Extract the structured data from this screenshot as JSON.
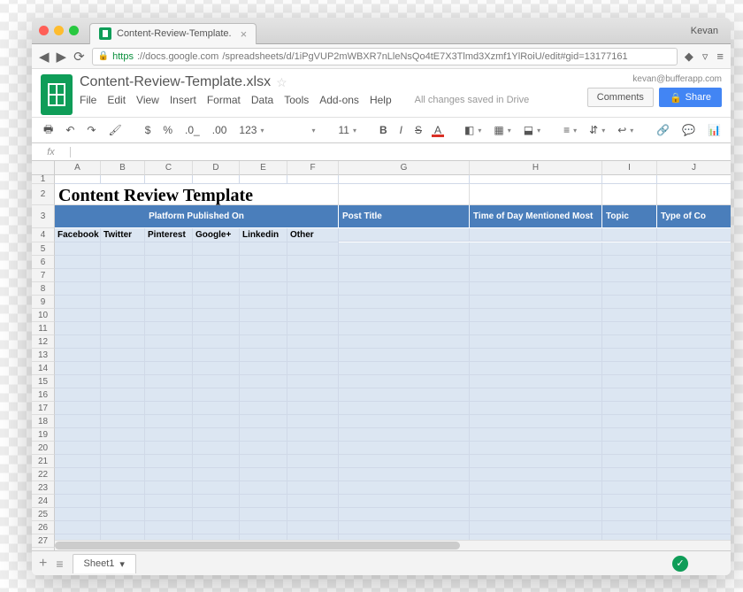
{
  "browser": {
    "tab_title": "Content-Review-Template.",
    "user": "Kevan",
    "https": "https",
    "url_host": "://docs.google.com",
    "url_path": "/spreadsheets/d/1iPgVUP2mWBXR7nLleNsQo4tE7X3Tlmd3Xzmf1YlRoiU/edit#gid=13177161"
  },
  "doc": {
    "title": "Content-Review-Template.xlsx",
    "email": "kevan@bufferapp.com",
    "comments_btn": "Comments",
    "share_btn": "Share",
    "save_status": "All changes saved in Drive",
    "menu": {
      "file": "File",
      "edit": "Edit",
      "view": "View",
      "insert": "Insert",
      "format": "Format",
      "data": "Data",
      "tools": "Tools",
      "addons": "Add-ons",
      "help": "Help"
    }
  },
  "toolbar": {
    "currency": "$",
    "percent": "%",
    "dec_dec": ".0_",
    "dec_inc": ".00",
    "fmt": "123",
    "font_size": "11",
    "bold": "B",
    "italic": "I",
    "strike": "S",
    "textA": "A"
  },
  "fx": {
    "label": "fx"
  },
  "columns": [
    "A",
    "B",
    "C",
    "D",
    "E",
    "F",
    "G",
    "H",
    "I",
    "J"
  ],
  "sheet": {
    "title_cell": "Content Review Template",
    "header_platform": "Platform Published On",
    "header_post": "Post Title",
    "header_time": "Time of Day Mentioned Most",
    "header_topic": "Topic",
    "header_type": "Type of Co",
    "platforms": {
      "fb": "Facebook",
      "tw": "Twitter",
      "pin": "Pinterest",
      "gp": "Google+",
      "li": "Linkedin",
      "other": "Other"
    }
  },
  "tabs": {
    "sheet1": "Sheet1"
  }
}
